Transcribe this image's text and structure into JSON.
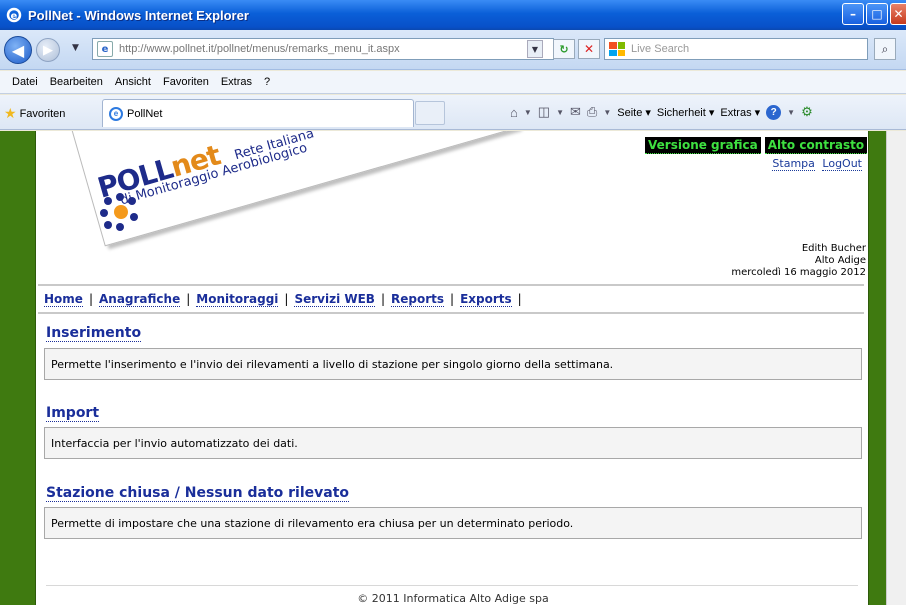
{
  "window": {
    "title": "PollNet - Windows Internet Explorer"
  },
  "addressbar": {
    "url": "http://www.pollnet.it/pollnet/menus/remarks_menu_it.aspx",
    "search_placeholder": "Live Search"
  },
  "menubar": {
    "items": [
      "Datei",
      "Bearbeiten",
      "Ansicht",
      "Favoriten",
      "Extras",
      "?"
    ]
  },
  "favbar": {
    "favorites_label": "Favoriten",
    "tab_title": "PollNet",
    "commands": [
      "Seite ▾",
      "Sicherheit ▾",
      "Extras ▾"
    ]
  },
  "site": {
    "logo": {
      "brand_a": "POLL",
      "brand_b": "net",
      "tagline_1": "Rete Italiana",
      "tagline_2": "di Monitoraggio Aerobiologico"
    },
    "top_links": {
      "graphic": "Versione grafica",
      "contrast": "Alto contrasto"
    },
    "util_links": {
      "print": "Stampa",
      "logout": "LogOut"
    },
    "user": {
      "name": "Edith Bucher",
      "region": "Alto Adige",
      "date": "mercoledì 16 maggio 2012"
    },
    "nav": [
      "Home",
      "Anagrafiche",
      "Monitoraggi",
      "Servizi WEB",
      "Reports",
      "Exports"
    ],
    "sections": [
      {
        "title": "Inserimento",
        "description": "Permette l'inserimento e l'invio dei rilevamenti a livello di stazione per singolo giorno della settimana."
      },
      {
        "title": "Import",
        "description": "Interfaccia per l'invio automatizzato dei dati."
      },
      {
        "title": "Stazione chiusa / Nessun dato rilevato",
        "description": "Permette di impostare che una stazione di rilevamento era chiusa per un determinato periodo."
      }
    ],
    "footer": "© 2011 Informatica Alto Adige spa"
  },
  "colors": {
    "frame_green": "#3f7a10",
    "link_blue": "#1a2e9a",
    "logo_orange": "#e38a1a",
    "contrast_green": "#3ee040"
  }
}
